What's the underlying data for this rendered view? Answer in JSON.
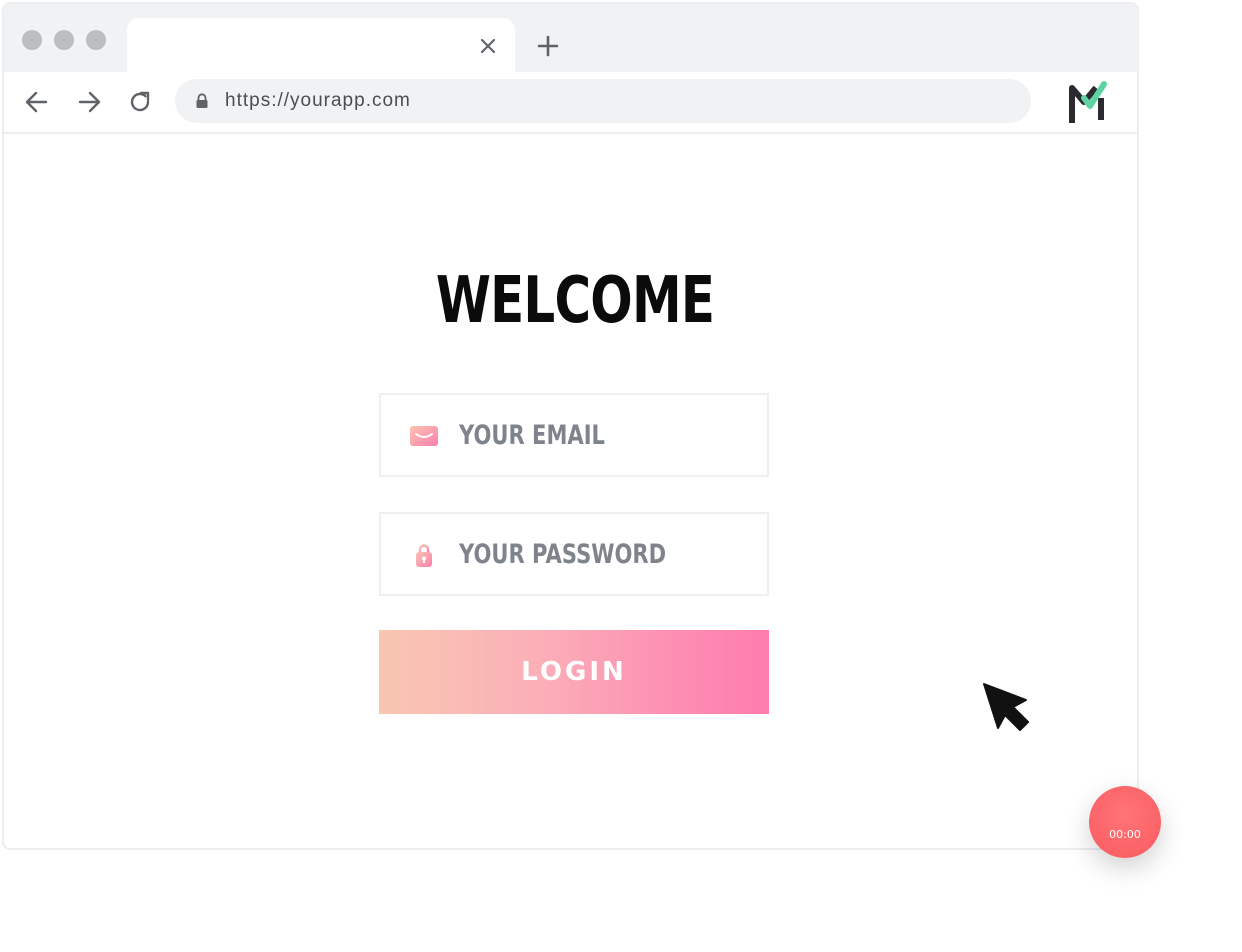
{
  "browser": {
    "window_controls": [
      "dot",
      "dot",
      "dot"
    ],
    "tab": {
      "title": "",
      "close_icon": "close-icon"
    },
    "new_tab_icon": "plus-icon",
    "nav": {
      "back_icon": "arrow-left-icon",
      "forward_icon": "arrow-right-icon",
      "reload_icon": "reload-icon"
    },
    "address_bar": {
      "lock_icon": "lock-icon",
      "url": "https://yourapp.com"
    },
    "extension_icon": "m-check-logo-icon"
  },
  "login": {
    "title": "WELCOME",
    "email": {
      "icon": "envelope-icon",
      "placeholder": "YOUR EMAIL",
      "value": ""
    },
    "password": {
      "icon": "padlock-icon",
      "placeholder": "YOUR PASSWORD",
      "value": ""
    },
    "login_button": "LOGIN"
  },
  "overlay": {
    "cursor_icon": "pointer-arrow-icon",
    "record_timer": "00:00"
  },
  "colors": {
    "login_gradient_start": "#f8c6b1",
    "login_gradient_end": "#fe7cae",
    "record_button": "#f95b60",
    "logo_green": "#5fd3a1",
    "logo_dark": "#2b2b2f"
  }
}
